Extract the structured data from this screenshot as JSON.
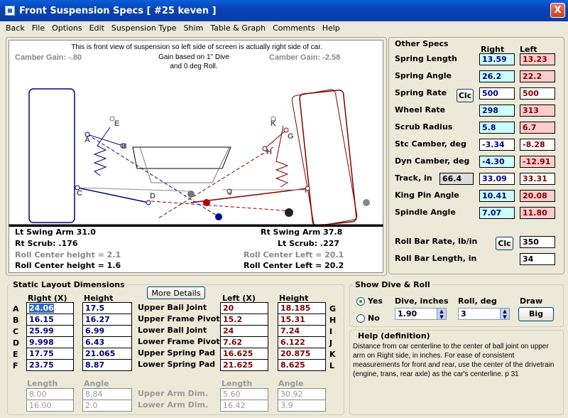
{
  "window": {
    "title": "Front Suspension Specs    [ #25 keven ]",
    "close": "X"
  },
  "menu": [
    "Back",
    "File",
    "Options",
    "Edit",
    "Suspension Type",
    "Shim",
    "Table & Graph",
    "Comments",
    "Help"
  ],
  "diagram": {
    "note1": "This is front view of suspension so left side of screen is actually right side of car.",
    "note2": "Gain based on 1\" Dive",
    "note3": "and 0 deg Roll.",
    "camber_left": "Camber Gain: -.80",
    "camber_right": "Camber Gain: -2.58",
    "labels_left": [
      "A",
      "B",
      "C",
      "D",
      "E",
      "F"
    ],
    "labels_right": [
      "G",
      "H",
      "I",
      "J",
      "K",
      "L"
    ],
    "lt_swing": "Lt Swing Arm 31.0",
    "rt_swing": "Rt Swing Arm 37.8",
    "rt_scrub": "Rt Scrub: .176",
    "lt_scrub": "Lt Scrub: .227",
    "rc_height_gray": "Roll Center height = 2.1",
    "rc_height": "Roll Center height = 1.6",
    "rc_left_gray": "Roll Center Left = 20.1",
    "rc_left": "Roll Center Left = 20.2"
  },
  "other": {
    "title": "Other Specs",
    "col_right": "Right",
    "col_left": "Left",
    "clc": "Clc",
    "rows": [
      {
        "label": "Spring Length",
        "right": "13.59",
        "left": "13.23"
      },
      {
        "label": "Spring Angle",
        "right": "26.2",
        "left": "22.2"
      },
      {
        "label": "Spring Rate",
        "right": "500",
        "left": "500"
      },
      {
        "label": "Wheel Rate",
        "right": "298",
        "left": "313"
      },
      {
        "label": "Scrub Radius",
        "right": "5.8",
        "left": "6.7"
      },
      {
        "label": "Stc Camber, deg",
        "right": "-3.34",
        "left": "-8.28"
      },
      {
        "label": "Dyn Camber, deg",
        "right": "-4.30",
        "left": "-12.91"
      },
      {
        "label": "Track, in",
        "track": "66.4",
        "right": "33.09",
        "left": "33.31"
      },
      {
        "label": "King Pin Angle",
        "right": "10.41",
        "left": "20.08"
      },
      {
        "label": "Spindle Angle",
        "right": "7.07",
        "left": "11.80"
      }
    ],
    "rollbar_rate_label": "Roll Bar Rate, lb/in",
    "rollbar_rate": "350",
    "rollbar_len_label": "Roll Bar Length, in",
    "rollbar_len": "34"
  },
  "static": {
    "title": "Static Layout Dimensions",
    "more": "More Details",
    "h_right": "Right (X)",
    "h_height": "Height",
    "h_left": "Left (X)",
    "h_height2": "Height",
    "rows": [
      {
        "l": "A",
        "rx": "24.06",
        "rh": "17.5",
        "name": "Upper Ball Joint",
        "lx": "20",
        "lh": "18.185",
        "r": "G"
      },
      {
        "l": "B",
        "rx": "16.15",
        "rh": "16.27",
        "name": "Upper Frame Pivot",
        "lx": "15.2",
        "lh": "15.31",
        "r": "H"
      },
      {
        "l": "C",
        "rx": "25.99",
        "rh": "6.99",
        "name": "Lower Ball Joint",
        "lx": "24",
        "lh": "7.24",
        "r": "I"
      },
      {
        "l": "D",
        "rx": "9.998",
        "rh": "6.43",
        "name": "Lower Frame Pivot",
        "lx": "7.62",
        "lh": "6.122",
        "r": "J"
      },
      {
        "l": "E",
        "rx": "17.75",
        "rh": "21.065",
        "name": "Upper Spring Pad",
        "lx": "16.625",
        "lh": "20.875",
        "r": "K"
      },
      {
        "l": "F",
        "rx": "23.75",
        "rh": "8.87",
        "name": "Lower Spring Pad",
        "lx": "21.625",
        "lh": "8.625",
        "r": "L"
      }
    ],
    "h_length": "Length",
    "h_angle": "Angle",
    "h_length2": "Length",
    "h_angle2": "Angle",
    "upper_dim": "Upper Arm Dim.",
    "lower_dim": "Lower Arm Dim.",
    "upper_r_len": "8.00",
    "upper_r_ang": "8.84",
    "upper_l_len": "5.60",
    "upper_l_ang": "30.92",
    "lower_r_len": "16.00",
    "lower_r_ang": "2.0",
    "lower_l_len": "16.42",
    "lower_l_ang": "3.9"
  },
  "dive": {
    "title": "Show Dive & Roll",
    "yes": "Yes",
    "no": "No",
    "dive_label": "Dive, inches",
    "dive": "1.90",
    "roll_label": "Roll, deg",
    "roll": "3",
    "draw_label": "Draw",
    "draw_btn": "Big"
  },
  "help": {
    "title": "Help (definition)",
    "text": "Distance from car centerline to the center of ball joint on upper arm on Right side, in inches.  For ease of consistent measurements for front and rear, use the center of the drivetrain (engine, trans, rear axle) as the car's centerline.  p 31"
  }
}
